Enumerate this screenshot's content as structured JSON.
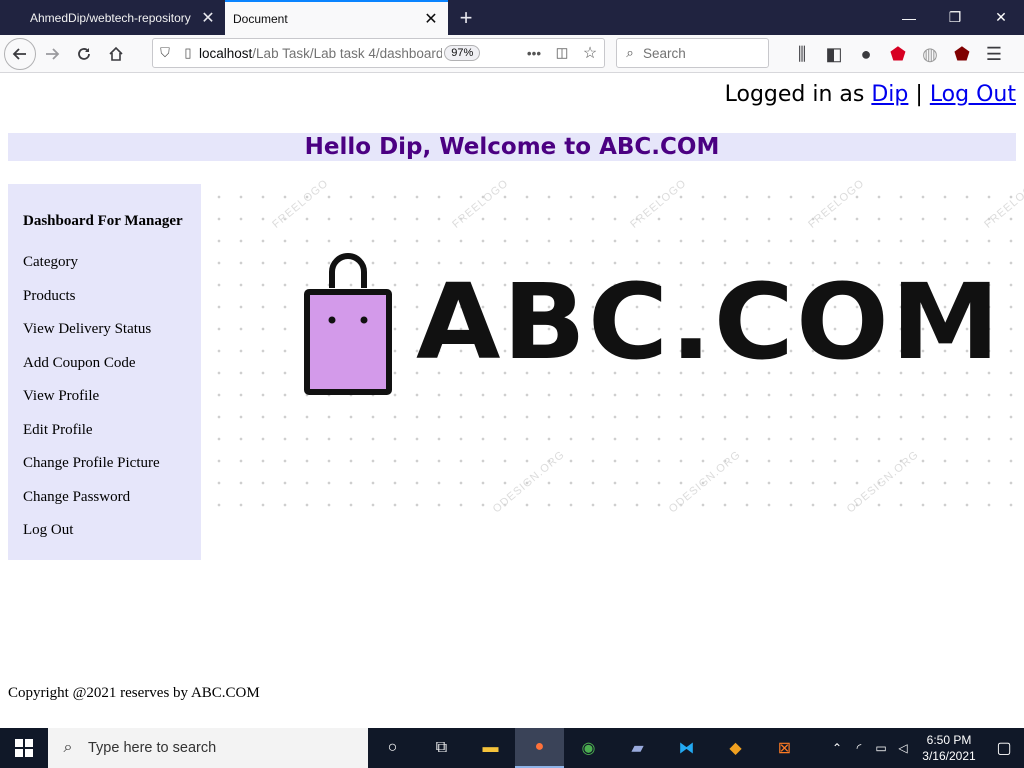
{
  "browser": {
    "tabs": [
      {
        "title": "AhmedDip/webtech-repository",
        "active": false
      },
      {
        "title": "Document",
        "active": true
      }
    ],
    "url_host": "localhost",
    "url_path": "/Lab Task/Lab task 4/dashboard",
    "zoom": "97%",
    "search_placeholder": "Search"
  },
  "header": {
    "logged_in_prefix": "Logged in as",
    "username": "Dip",
    "separator": "|",
    "logout": "Log Out",
    "welcome": "Hello Dip, Welcome to ABC.COM"
  },
  "sidebar": {
    "title": "Dashboard For Manager",
    "items": [
      {
        "label": "Category"
      },
      {
        "label": "Products"
      },
      {
        "label": "View Delivery Status"
      },
      {
        "label": "Add Coupon Code"
      },
      {
        "label": "View Profile"
      },
      {
        "label": "Edit Profile"
      },
      {
        "label": "Change Profile Picture"
      },
      {
        "label": "Change Password"
      },
      {
        "label": "Log Out"
      }
    ]
  },
  "logo": {
    "text": "ABC.COM",
    "bag_color": "#d39aea",
    "watermark_a": "FREELOGO",
    "watermark_b": "ODESIGN.ORG"
  },
  "footer": {
    "copyright": "Copyright @2021 reserves by ABC.COM"
  },
  "taskbar": {
    "search_placeholder": "Type here to search",
    "time": "6:50 PM",
    "date": "3/16/2021"
  },
  "colors": {
    "welcome_bg": "#e6e6fa",
    "welcome_text": "#4b0082",
    "link": "#0000ee",
    "taskbar": "#101828",
    "titlebar": "#202340"
  }
}
